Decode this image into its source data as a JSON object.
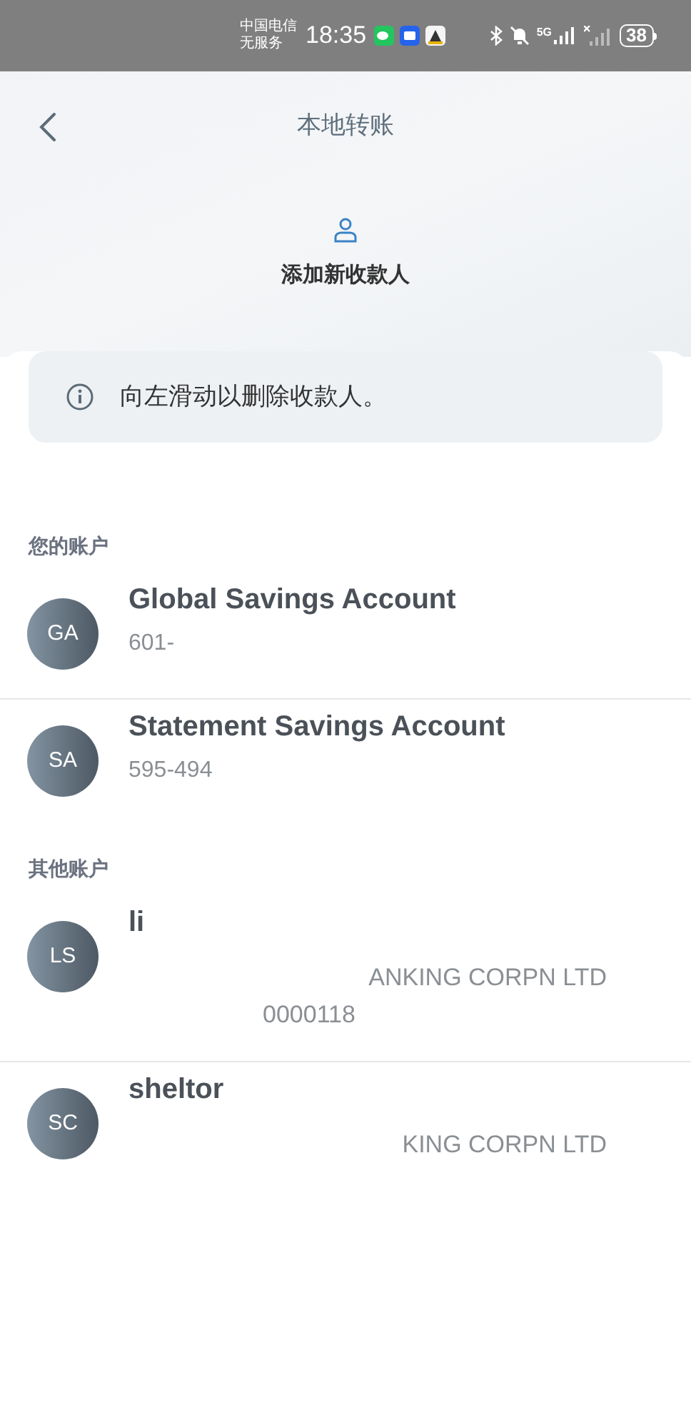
{
  "status_bar": {
    "carrier": [
      "中国电信",
      "无服务"
    ],
    "time": "18:35",
    "network": "5G",
    "battery": "38"
  },
  "header": {
    "title": "本地转账"
  },
  "add_payee": {
    "label": "添加新收款人"
  },
  "notice": {
    "text": "向左滑动以删除收款人。"
  },
  "sections": [
    {
      "title": "您的账户",
      "accounts": [
        {
          "initials": "GA",
          "name": "Global Savings Account",
          "lines": [
            {
              "kind": "number",
              "text": "601-"
            }
          ]
        },
        {
          "initials": "SA",
          "name": "Statement Savings Account",
          "lines": [
            {
              "kind": "number",
              "text": "595-494"
            }
          ]
        }
      ]
    },
    {
      "title": "其他账户",
      "accounts": [
        {
          "initials": "LS",
          "name": "li",
          "lines": [
            {
              "kind": "bank",
              "text": "ANKING CORPN LTD"
            },
            {
              "kind": "masked_number",
              "text": "0000118"
            }
          ]
        },
        {
          "initials": "SC",
          "name": "sheltor",
          "lines": [
            {
              "kind": "bank",
              "text": "KING CORPN LTD"
            }
          ]
        }
      ]
    }
  ]
}
